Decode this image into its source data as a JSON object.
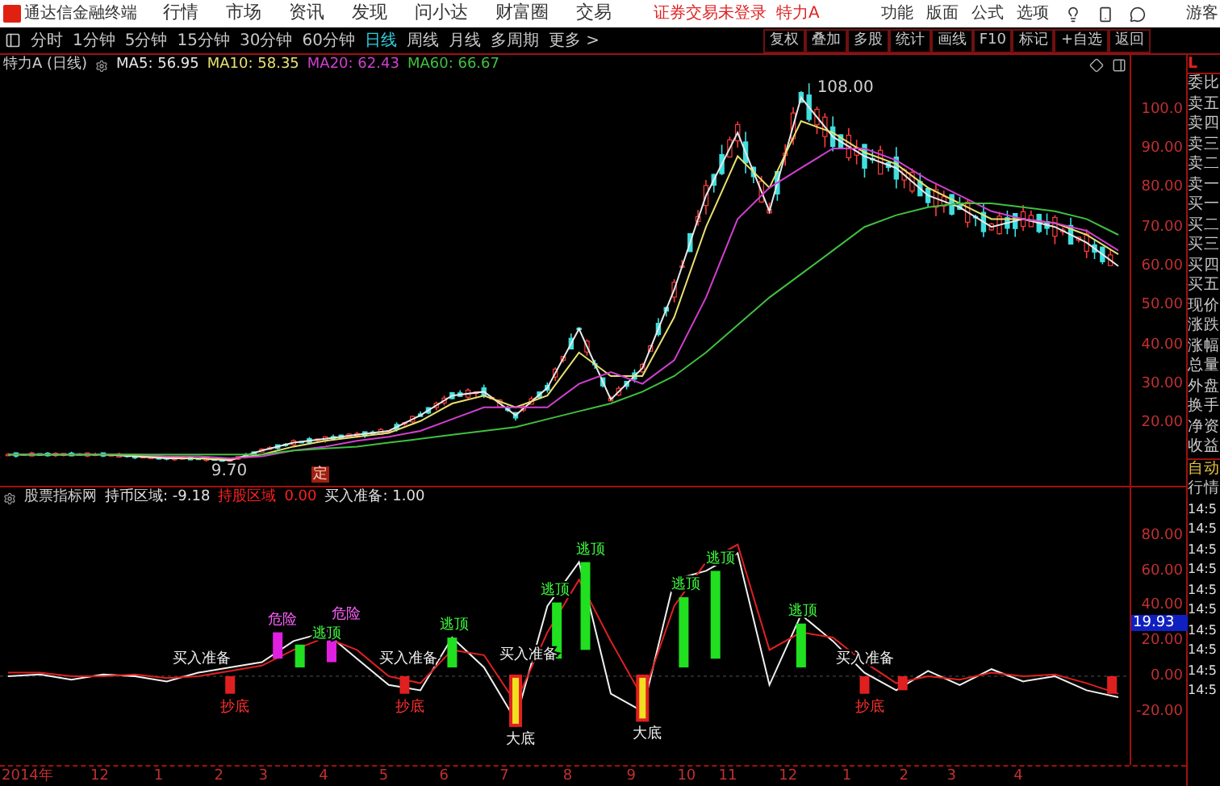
{
  "title_bar": {
    "app_name": "通达信金融终端",
    "menu": [
      "行情",
      "市场",
      "资讯",
      "发现",
      "问小达",
      "财富圈",
      "交易"
    ],
    "login_status": "证券交易未登录",
    "stock": "特力A",
    "functions": [
      "功能",
      "版面",
      "公式",
      "选项"
    ],
    "user": "游客"
  },
  "periods": [
    {
      "label": "分时",
      "selected": false
    },
    {
      "label": "1分钟",
      "selected": false
    },
    {
      "label": "5分钟",
      "selected": false
    },
    {
      "label": "15分钟",
      "selected": false
    },
    {
      "label": "30分钟",
      "selected": false
    },
    {
      "label": "60分钟",
      "selected": false
    },
    {
      "label": "日线",
      "selected": true
    },
    {
      "label": "周线",
      "selected": false
    },
    {
      "label": "月线",
      "selected": false
    },
    {
      "label": "多周期",
      "selected": false
    },
    {
      "label": "更多 >",
      "selected": false
    }
  ],
  "tools": [
    "复权",
    "叠加",
    "多股",
    "统计",
    "画线",
    "F10",
    "标记",
    "+自选",
    "返回"
  ],
  "price_chart": {
    "title": "特力A (日线)",
    "readouts": [
      {
        "text": "MA5: 56.95",
        "color": "#e8e8e8"
      },
      {
        "text": "MA10: 58.35",
        "color": "#e8e070"
      },
      {
        "text": "MA20: 62.43",
        "color": "#d040d0"
      },
      {
        "text": "MA60: 66.67",
        "color": "#40c040"
      }
    ],
    "marker": "定",
    "price_labels": [
      "108.00",
      "9.70"
    ],
    "y_axis": [
      "100.0",
      "90.00",
      "80.00",
      "70.00",
      "60.00",
      "50.00",
      "40.00",
      "30.00",
      "20.00"
    ]
  },
  "indicator_chart": {
    "name": "股票指标网",
    "readouts": [
      {
        "text": "持币区域: -9.18",
        "color": "#e0e0e0"
      },
      {
        "text": "持股区域",
        "color": "#ff2020"
      },
      {
        "text": "0.00",
        "color": "#ff2020"
      },
      {
        "text": "买入准备: 1.00",
        "color": "#e0e0e0"
      }
    ],
    "y_axis": [
      "80.00",
      "60.00",
      "40.00",
      "20.00",
      "0.00",
      "-20.00"
    ],
    "current_value": "19.93",
    "signals": [
      {
        "kind": "danger",
        "text": "危险"
      },
      {
        "kind": "top",
        "text": "逃顶"
      },
      {
        "kind": "danger",
        "text": "危险"
      },
      {
        "kind": "top",
        "text": "逃顶"
      },
      {
        "kind": "top",
        "text": "逃顶"
      },
      {
        "kind": "top",
        "text": "逃顶"
      },
      {
        "kind": "top",
        "text": "逃顶"
      },
      {
        "kind": "top",
        "text": "逃顶"
      },
      {
        "kind": "top",
        "text": "逃顶"
      },
      {
        "kind": "bottom",
        "text": "抄底"
      },
      {
        "kind": "bottom",
        "text": "抄底"
      },
      {
        "kind": "deep_bottom",
        "text": "大底"
      },
      {
        "kind": "deep_bottom",
        "text": "大底"
      },
      {
        "kind": "bottom",
        "text": "抄底"
      },
      {
        "kind": "note",
        "text": "买入准备"
      },
      {
        "kind": "note",
        "text": "买入准备"
      },
      {
        "kind": "note",
        "text": "买入准备"
      },
      {
        "kind": "note",
        "text": "买入准备"
      }
    ]
  },
  "date_axis": [
    "2014年",
    "12",
    "1",
    "2",
    "3",
    "4",
    "5",
    "6",
    "7",
    "8",
    "9",
    "10",
    "11",
    "12",
    "1",
    "2",
    "3",
    "4"
  ],
  "quote_panel": {
    "logo": "L",
    "fields": [
      "委比",
      "卖五",
      "卖四",
      "卖三",
      "卖二",
      "卖一",
      "买一",
      "买二",
      "买三",
      "买四",
      "买五",
      "现价",
      "涨跌",
      "涨幅",
      "总量",
      "外盘",
      "换手",
      "净资",
      "收益"
    ],
    "mode": [
      "自动",
      "行情"
    ],
    "ticks": [
      "14:5",
      "14:5",
      "14:5",
      "14:5",
      "14:5",
      "14:5",
      "14:5",
      "14:5",
      "14:5",
      "14:5"
    ]
  }
}
